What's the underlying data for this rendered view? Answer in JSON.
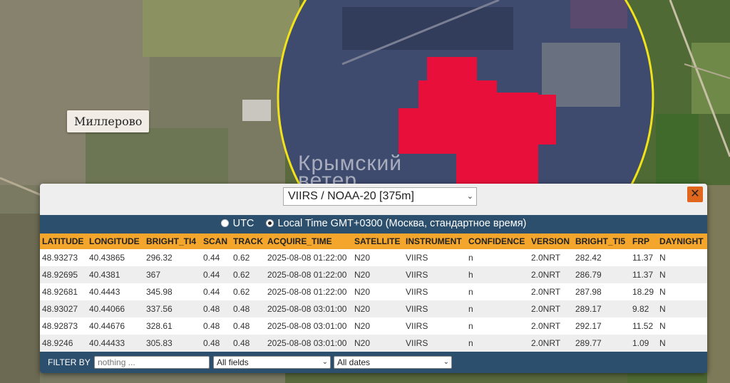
{
  "map": {
    "town_label": "Миллерово",
    "watermark_line1": "Крымский",
    "watermark_line2": "ветер"
  },
  "panel": {
    "source_select": "VIIRS / NOAA-20 [375m]",
    "close_label": "✕",
    "tz_utc_label": "UTC",
    "tz_local_label": "Local Time GMT+0300 (Москва, стандартное время)",
    "tz_selected": "local"
  },
  "table": {
    "columns": [
      "LATITUDE",
      "LONGITUDE",
      "BRIGHT_TI4",
      "SCAN",
      "TRACK",
      "ACQUIRE_TIME",
      "SATELLITE",
      "INSTRUMENT",
      "CONFIDENCE",
      "VERSION",
      "BRIGHT_TI5",
      "FRP",
      "DAYNIGHT"
    ],
    "rows": [
      [
        "48.93273",
        "40.43865",
        "296.32",
        "0.44",
        "0.62",
        "2025-08-08 01:22:00",
        "N20",
        "VIIRS",
        "n",
        "2.0NRT",
        "282.42",
        "11.37",
        "N"
      ],
      [
        "48.92695",
        "40.4381",
        "367",
        "0.44",
        "0.62",
        "2025-08-08 01:22:00",
        "N20",
        "VIIRS",
        "h",
        "2.0NRT",
        "286.79",
        "11.37",
        "N"
      ],
      [
        "48.92681",
        "40.4443",
        "345.98",
        "0.44",
        "0.62",
        "2025-08-08 01:22:00",
        "N20",
        "VIIRS",
        "n",
        "2.0NRT",
        "287.98",
        "18.29",
        "N"
      ],
      [
        "48.93027",
        "40.44066",
        "337.56",
        "0.48",
        "0.48",
        "2025-08-08 03:01:00",
        "N20",
        "VIIRS",
        "n",
        "2.0NRT",
        "289.17",
        "9.82",
        "N"
      ],
      [
        "48.92873",
        "40.44676",
        "328.61",
        "0.48",
        "0.48",
        "2025-08-08 03:01:00",
        "N20",
        "VIIRS",
        "n",
        "2.0NRT",
        "292.17",
        "11.52",
        "N"
      ],
      [
        "48.9246",
        "40.44433",
        "305.83",
        "0.48",
        "0.48",
        "2025-08-08 03:01:00",
        "N20",
        "VIIRS",
        "n",
        "2.0NRT",
        "289.77",
        "1.09",
        "N"
      ]
    ]
  },
  "filter": {
    "label": "FILTER BY",
    "placeholder": "nothing ...",
    "fields_select": "All fields",
    "dates_select": "All dates"
  },
  "colors": {
    "fire_area": "#e8103a",
    "circle": "#f2e21a",
    "header_bg": "#f4a52b",
    "panel_bg": "#2c4f6e"
  }
}
